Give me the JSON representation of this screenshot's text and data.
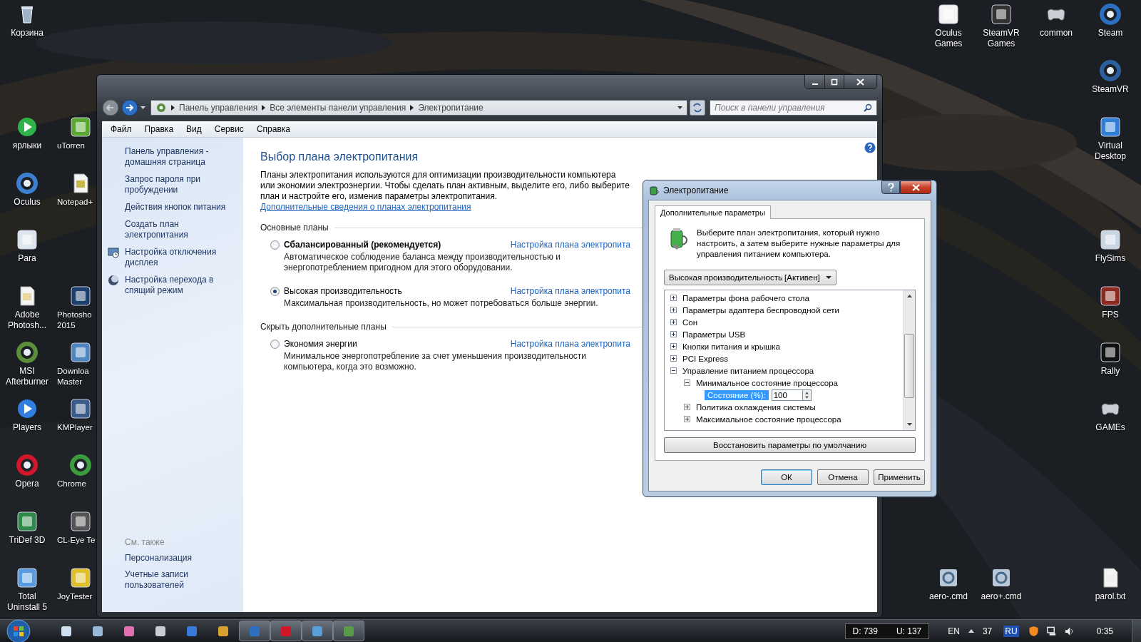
{
  "desktop_icons": [
    {
      "label": "Корзина"
    },
    {
      "label": "ярлыки"
    },
    {
      "label": "uTorren"
    },
    {
      "label": "Oculus"
    },
    {
      "label": "Notepad+"
    },
    {
      "label": "Para"
    },
    {
      "label": "Adobe Photosh..."
    },
    {
      "label": "Photosho 2015"
    },
    {
      "label": "MSI Afterburner"
    },
    {
      "label": "Downloa Master"
    },
    {
      "label": "Players"
    },
    {
      "label": "KMPlayer"
    },
    {
      "label": "Opera"
    },
    {
      "label": "Chrome"
    },
    {
      "label": "TriDef 3D"
    },
    {
      "label": "CL-Eye Te"
    },
    {
      "label": "Total Uninstall 5"
    },
    {
      "label": "JoyTester"
    },
    {
      "label": "Oculus Games"
    },
    {
      "label": "SteamVR Games"
    },
    {
      "label": "common"
    },
    {
      "label": "Steam"
    },
    {
      "label": "SteamVR"
    },
    {
      "label": "Virtual Desktop"
    },
    {
      "label": "FlySims"
    },
    {
      "label": "FPS"
    },
    {
      "label": "Rally"
    },
    {
      "label": "GAMEs"
    },
    {
      "label": "aero-.cmd"
    },
    {
      "label": "aero+.cmd"
    },
    {
      "label": "parol.txt"
    }
  ],
  "window": {
    "breadcrumb": [
      "Панель управления",
      "Все элементы панели управления",
      "Электропитание"
    ],
    "search": {
      "placeholder": "Поиск в панели управления"
    },
    "menu": [
      "Файл",
      "Правка",
      "Вид",
      "Сервис",
      "Справка"
    ],
    "sidebar": {
      "items": [
        {
          "label": "Панель управления - домашняя страница"
        },
        {
          "label": "Запрос пароля при пробуждении"
        },
        {
          "label": "Действия кнопок питания"
        },
        {
          "label": "Создать план электропитания"
        },
        {
          "label": "Настройка отключения дисплея",
          "kind": "display"
        },
        {
          "label": "Настройка перехода в спящий режим",
          "kind": "sleep"
        }
      ],
      "see_also_title": "См. также",
      "see_also": [
        "Персонализация",
        "Учетные записи пользователей"
      ]
    },
    "title": "Выбор плана электропитания",
    "intro": "Планы электропитания используются для оптимизации производительности компьютера или экономии электроэнергии. Чтобы сделать план активным, выделите его, либо выберите план и настройте его, изменив параметры электропитания.",
    "intro_link": "Дополнительные сведения о планах электропитания",
    "groups": [
      {
        "title": "Основные планы",
        "plans": [
          {
            "name": "Сбалансированный (рекомендуется)",
            "bold": true,
            "selected": false,
            "link": "Настройка плана электропита",
            "description": "Автоматическое соблюдение баланса между производительностью и энергопотреблением пригодном для этого оборудовании."
          },
          {
            "name": "Высокая производительность",
            "bold": false,
            "selected": true,
            "link": "Настройка плана электропита",
            "description": "Максимальная производительность, но может потребоваться больше энергии."
          }
        ]
      },
      {
        "title": "Скрыть дополнительные планы",
        "plans": [
          {
            "name": "Экономия энергии",
            "bold": false,
            "selected": false,
            "link": "Настройка плана электропита",
            "description": "Минимальное энергопотребление за счет уменьшения производительности компьютера, когда это возможно."
          }
        ]
      }
    ]
  },
  "dialog": {
    "title": "Электропитание",
    "tabs": [
      {
        "label": "Дополнительные параметры",
        "selected": true
      }
    ],
    "instruction": "Выберите план электропитания, который нужно настроить, а затем выберите нужные параметры для управления питанием компьютера.",
    "plan_select": "Высокая производительность [Активен]",
    "tree": [
      {
        "label": "Параметры фона рабочего стола",
        "expanded": false
      },
      {
        "label": "Параметры адаптера беспроводной сети",
        "expanded": false
      },
      {
        "label": "Сон",
        "expanded": false
      },
      {
        "label": "Параметры USB",
        "expanded": false
      },
      {
        "label": "Кнопки питания и крышка",
        "expanded": false
      },
      {
        "label": "PCI Express",
        "expanded": false
      },
      {
        "label": "Управление питанием процессора",
        "expanded": true,
        "children": [
          {
            "label": "Минимальное состояние процессора",
            "expanded": true,
            "children": [
              {
                "kind": "setting",
                "label": "Состояние (%):",
                "value": "100",
                "selected": true
              }
            ]
          },
          {
            "label": "Политика охлаждения системы",
            "expanded": false
          },
          {
            "label": "Максимальное состояние процессора",
            "expanded": false
          }
        ]
      }
    ],
    "restore_button": "Восстановить параметры по умолчанию",
    "buttons": [
      {
        "label": "ОК",
        "default": true
      },
      {
        "label": "Отмена",
        "default": false
      },
      {
        "label": "Применить",
        "default": false
      }
    ]
  },
  "taskbar": {
    "items": [
      {
        "running": false
      },
      {
        "running": false
      },
      {
        "running": false
      },
      {
        "running": false
      },
      {
        "running": false
      },
      {
        "running": false
      },
      {
        "running": true
      },
      {
        "running": true
      },
      {
        "running": true
      },
      {
        "running": true
      }
    ],
    "meters": [
      "D: 739",
      "U: 137"
    ],
    "language": "EN",
    "tray_count": "37",
    "input_language": "RU",
    "clock": "0:35"
  }
}
